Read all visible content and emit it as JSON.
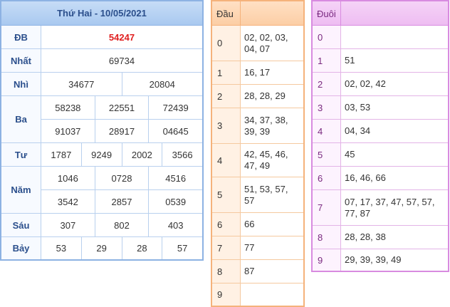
{
  "results": {
    "title": "Thứ Hai - 10/05/2021",
    "prizes": [
      {
        "label": "ĐB",
        "lines": [
          [
            "54247"
          ]
        ]
      },
      {
        "label": "Nhất",
        "lines": [
          [
            "69734"
          ]
        ]
      },
      {
        "label": "Nhì",
        "lines": [
          [
            "34677",
            "20804"
          ]
        ]
      },
      {
        "label": "Ba",
        "lines": [
          [
            "58238",
            "22551",
            "72439"
          ],
          [
            "91037",
            "28917",
            "04645"
          ]
        ]
      },
      {
        "label": "Tư",
        "lines": [
          [
            "1787",
            "9249",
            "2002",
            "3566"
          ]
        ]
      },
      {
        "label": "Năm",
        "lines": [
          [
            "1046",
            "0728",
            "4516"
          ],
          [
            "3542",
            "2857",
            "0539"
          ]
        ]
      },
      {
        "label": "Sáu",
        "lines": [
          [
            "307",
            "802",
            "403"
          ]
        ]
      },
      {
        "label": "Bảy",
        "lines": [
          [
            "53",
            "29",
            "28",
            "57"
          ]
        ]
      }
    ],
    "special_color": "#e02020"
  },
  "dau": {
    "header": "Đầu",
    "rows": [
      {
        "key": "0",
        "values": "02, 02, 03, 04, 07"
      },
      {
        "key": "1",
        "values": "16, 17"
      },
      {
        "key": "2",
        "values": "28, 28, 29"
      },
      {
        "key": "3",
        "values": "34, 37, 38, 39, 39"
      },
      {
        "key": "4",
        "values": "42, 45, 46, 47, 49"
      },
      {
        "key": "5",
        "values": "51, 53, 57, 57"
      },
      {
        "key": "6",
        "values": "66"
      },
      {
        "key": "7",
        "values": "77"
      },
      {
        "key": "8",
        "values": "87"
      },
      {
        "key": "9",
        "values": ""
      }
    ]
  },
  "duoi": {
    "header": "Đuôi",
    "rows": [
      {
        "key": "0",
        "values": ""
      },
      {
        "key": "1",
        "values": "51"
      },
      {
        "key": "2",
        "values": "02, 02, 42"
      },
      {
        "key": "3",
        "values": "03, 53"
      },
      {
        "key": "4",
        "values": "04, 34"
      },
      {
        "key": "5",
        "values": "45"
      },
      {
        "key": "6",
        "values": "16, 46, 66"
      },
      {
        "key": "7",
        "values": "07, 17, 37, 47, 57, 57, 77, 87"
      },
      {
        "key": "8",
        "values": "28, 28, 38"
      },
      {
        "key": "9",
        "values": "29, 39, 39, 49"
      }
    ]
  }
}
